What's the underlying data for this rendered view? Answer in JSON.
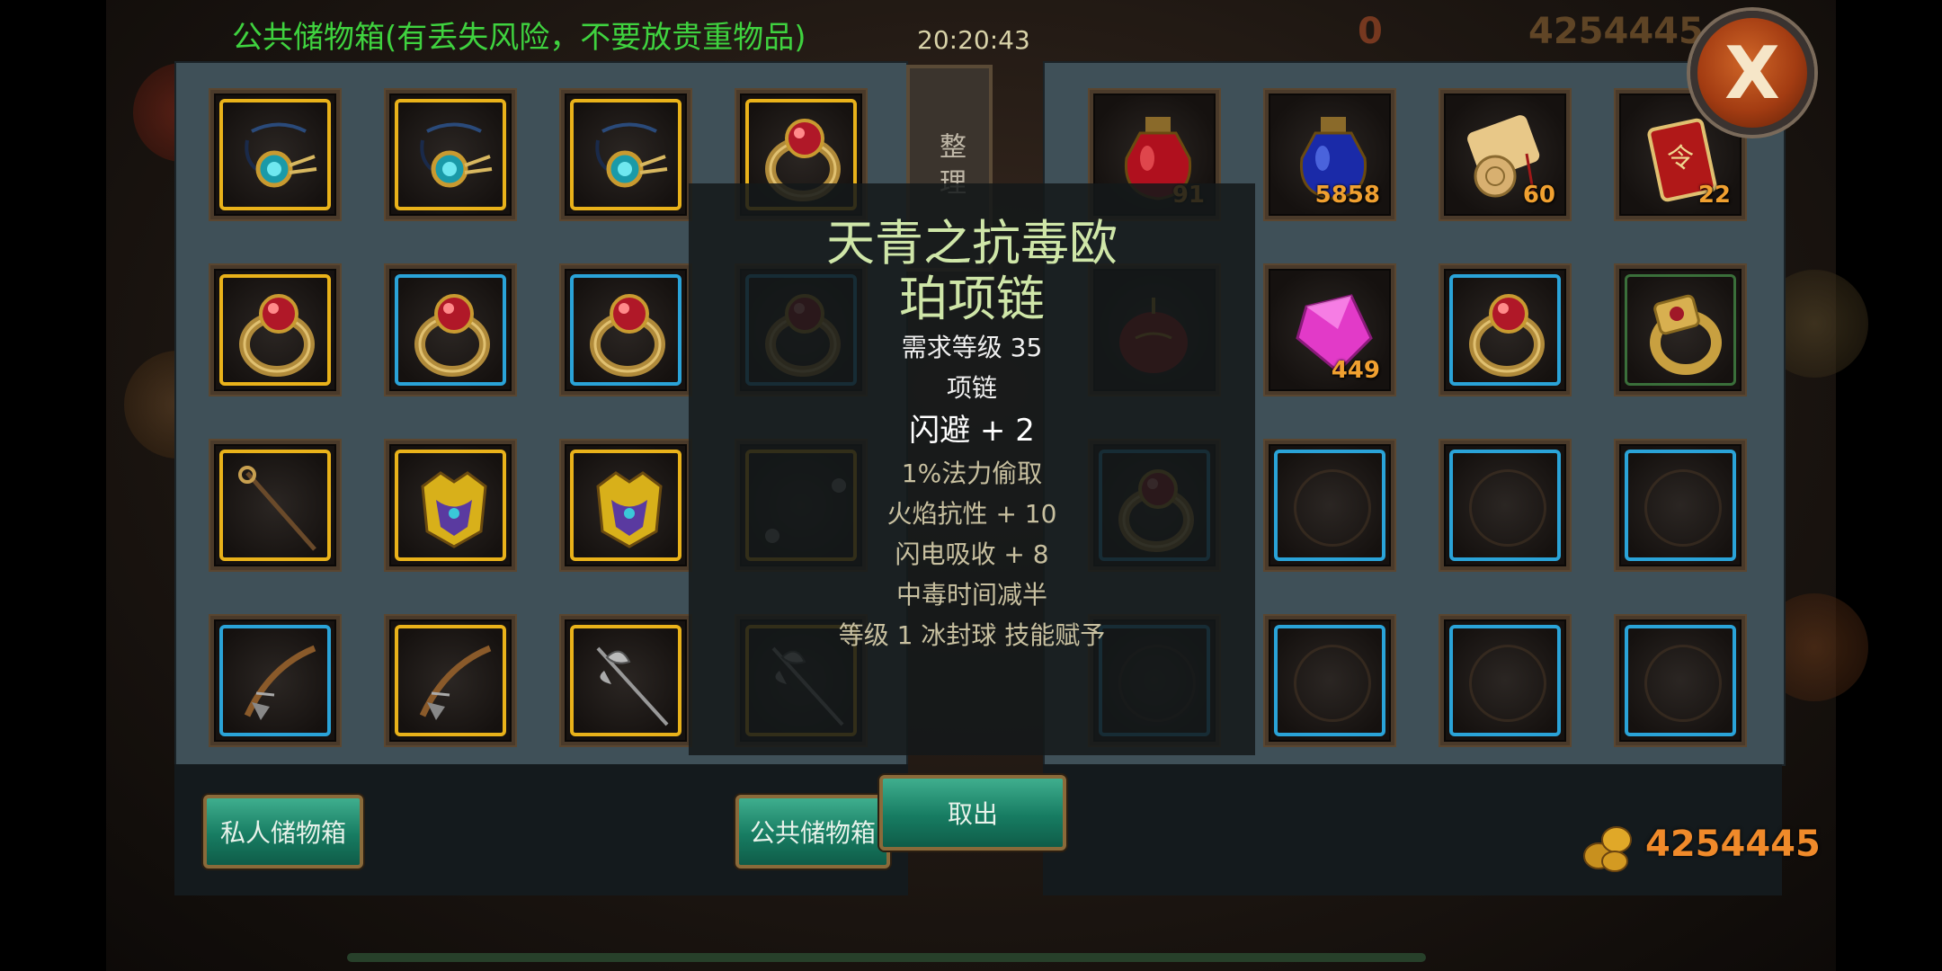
{
  "header": {
    "title": "公共储物箱(有丢失风险，不要放贵重物品)",
    "time": "20:20:43",
    "gold": "4254445",
    "gems": "0"
  },
  "buttons": {
    "tidy": "整理",
    "private_storage": "私人储物箱",
    "public_storage": "公共储物箱",
    "take_out": "取出",
    "close": "X"
  },
  "tooltip": {
    "name_line1": "天青之抗毒欧",
    "name_line2": "珀项链",
    "level_req": "需求等级 35",
    "type": "项链",
    "main_stat": "闪避 + 2",
    "effects": [
      "1%法力偷取",
      "火焰抗性 + 10",
      "闪电吸收 + 8",
      "中毒时间减半",
      "等级 1 冰封球 技能赋予"
    ]
  },
  "left_slots": [
    {
      "item": "necklace-icon",
      "frame": "gold"
    },
    {
      "item": "necklace-icon",
      "frame": "gold"
    },
    {
      "item": "necklace-icon",
      "frame": "gold"
    },
    {
      "item": "ring-icon",
      "frame": "gold"
    },
    {
      "item": "ring-icon",
      "frame": "gold"
    },
    {
      "item": "ring-icon",
      "frame": "blue"
    },
    {
      "item": "ring-icon",
      "frame": "blue"
    },
    {
      "item": "ring-icon",
      "frame": "blue"
    },
    {
      "item": "staff-icon",
      "frame": "gold"
    },
    {
      "item": "armor-icon",
      "frame": "gold"
    },
    {
      "item": "armor-icon",
      "frame": "gold"
    },
    {
      "item": "flail-icon",
      "frame": "gold"
    },
    {
      "item": "crossbow-icon",
      "frame": "blue"
    },
    {
      "item": "crossbow-icon",
      "frame": "gold"
    },
    {
      "item": "axe-icon",
      "frame": "gold"
    },
    {
      "item": "axe-icon",
      "frame": "gold"
    }
  ],
  "right_slots": [
    {
      "item": "red-potion-icon",
      "frame": "none",
      "qty": "91"
    },
    {
      "item": "blue-potion-icon",
      "frame": "none",
      "qty": "5858"
    },
    {
      "item": "scroll-icon",
      "frame": "none",
      "qty": "60"
    },
    {
      "item": "token-icon",
      "frame": "none",
      "qty": "22"
    },
    {
      "item": "lantern-icon",
      "frame": "none",
      "qty": ""
    },
    {
      "item": "gem-icon",
      "frame": "none",
      "qty": "449"
    },
    {
      "item": "ring-icon",
      "frame": "blue",
      "qty": ""
    },
    {
      "item": "signet-ring-icon",
      "frame": "green",
      "qty": ""
    },
    {
      "item": "ring-icon",
      "frame": "blue",
      "qty": ""
    },
    {
      "item": "empty",
      "frame": "blue",
      "qty": ""
    },
    {
      "item": "empty",
      "frame": "blue",
      "qty": ""
    },
    {
      "item": "empty",
      "frame": "blue",
      "qty": ""
    },
    {
      "item": "empty",
      "frame": "blue",
      "qty": ""
    },
    {
      "item": "empty",
      "frame": "blue",
      "qty": ""
    },
    {
      "item": "empty",
      "frame": "blue",
      "qty": ""
    },
    {
      "item": "empty",
      "frame": "blue",
      "qty": ""
    }
  ],
  "footer": {
    "gold_amount": "4254445"
  }
}
